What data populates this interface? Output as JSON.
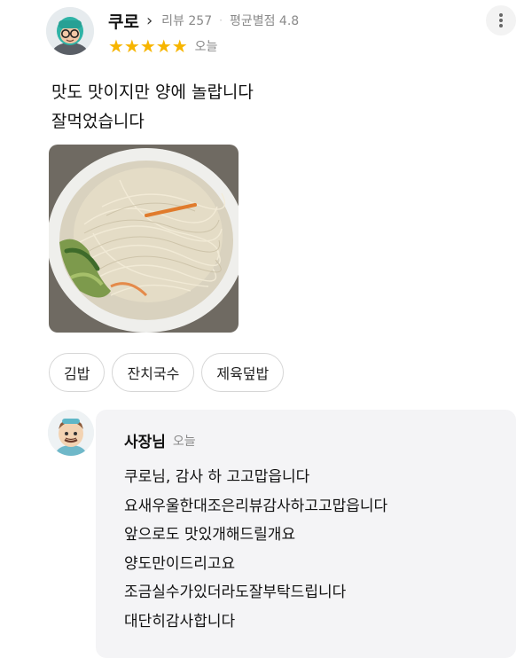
{
  "review": {
    "nickname": "쿠로",
    "chevron": "›",
    "review_count_label": "리뷰 257",
    "rating_avg_label": "평균별점 4.8",
    "stars": "★★★★★",
    "rating": 5,
    "date": "오늘",
    "text_lines": [
      "맛도 맛이지만 양에 놀랍니다",
      "잘먹었습니다"
    ],
    "more_icon": "more-vertical-icon"
  },
  "tags": [
    "김밥",
    "잔치국수",
    "제육덮밥"
  ],
  "owner_reply": {
    "name": "사장님",
    "date": "오늘",
    "lines": [
      "쿠로님, 감사 하 고고맙읍니다",
      "요새우울한대조은리뷰감사하고고맙읍니다",
      "앞으로도 맛있개해드릴개요",
      "양도만이드리고요",
      "조금실수가있더라도잘부탁드립니다",
      "대단히감사합니다"
    ]
  },
  "colors": {
    "star": "#f7b500",
    "meta_gray": "#8a8a8a",
    "reply_bg": "#f4f4f6"
  }
}
